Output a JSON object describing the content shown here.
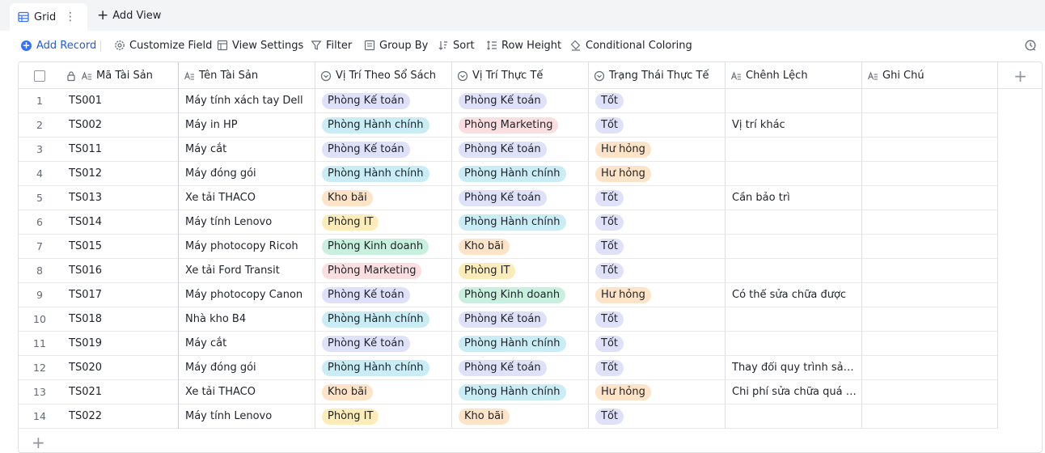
{
  "view_tab": {
    "label": "Grid",
    "more": "⋮"
  },
  "add_view": {
    "label": "Add View",
    "plus": "+"
  },
  "toolbar": {
    "add_record": "Add Record",
    "customize_field": "Customize Field",
    "view_settings": "View Settings",
    "filter": "Filter",
    "group_by": "Group By",
    "sort": "Sort",
    "row_height": "Row Height",
    "conditional_coloring": "Conditional Coloring"
  },
  "columns": [
    "Mã Tài Sản",
    "Tên Tài Sản",
    "Vị Trí Theo Sổ Sách",
    "Vị Trí Thực Tế",
    "Trạng Thái Thực Tế",
    "Chênh Lệch",
    "Ghi Chú"
  ],
  "colors": {
    "accent": "#3370ff",
    "tag_ketoan": "#dfe1f9",
    "tag_hanhchinh": "#c9ecf5",
    "tag_marketing": "#fbdedf",
    "tag_khobai": "#fde3c7",
    "tag_it": "#fcecb9",
    "tag_kinhdoanh": "#c9f0df",
    "tag_tot": "#dfe1f9",
    "tag_huhong": "#fde3c7"
  },
  "rows": [
    {
      "n": "1",
      "code": "TS001",
      "name": "Máy tính xách tay Dell",
      "book": "Phòng Kế toán",
      "actual": "Phòng Kế toán",
      "status": "Tốt",
      "diff": "",
      "note": ""
    },
    {
      "n": "2",
      "code": "TS002",
      "name": "Máy in HP",
      "book": "Phòng Hành chính",
      "actual": "Phòng Marketing",
      "status": "Tốt",
      "diff": "Vị trí khác",
      "note": ""
    },
    {
      "n": "3",
      "code": "TS011",
      "name": "Máy cắt",
      "book": "Phòng Kế toán",
      "actual": "Phòng Kế toán",
      "status": "Hư hỏng",
      "diff": "",
      "note": ""
    },
    {
      "n": "4",
      "code": "TS012",
      "name": "Máy đóng gói",
      "book": "Phòng Hành chính",
      "actual": "Phòng Hành chính",
      "status": "Hư hỏng",
      "diff": "",
      "note": ""
    },
    {
      "n": "5",
      "code": "TS013",
      "name": "Xe tải THACO",
      "book": "Kho bãi",
      "actual": "Phòng Kế toán",
      "status": "Tốt",
      "diff": "Cần bảo trì",
      "note": ""
    },
    {
      "n": "6",
      "code": "TS014",
      "name": "Máy tính Lenovo",
      "book": "Phòng IT",
      "actual": "Phòng Hành chính",
      "status": "Tốt",
      "diff": "",
      "note": ""
    },
    {
      "n": "7",
      "code": "TS015",
      "name": "Máy photocopy Ricoh",
      "book": "Phòng Kinh doanh",
      "actual": "Kho bãi",
      "status": "Tốt",
      "diff": "",
      "note": ""
    },
    {
      "n": "8",
      "code": "TS016",
      "name": "Xe tải Ford Transit",
      "book": "Phòng Marketing",
      "actual": "Phòng IT",
      "status": "Tốt",
      "diff": "",
      "note": ""
    },
    {
      "n": "9",
      "code": "TS017",
      "name": "Máy photocopy Canon",
      "book": "Phòng Kế toán",
      "actual": "Phòng Kinh doanh",
      "status": "Hư hỏng",
      "diff": "Có thể sửa chữa được",
      "note": ""
    },
    {
      "n": "10",
      "code": "TS018",
      "name": "Nhà kho B4",
      "book": "Phòng Hành chính",
      "actual": "Phòng Kế toán",
      "status": "Tốt",
      "diff": "",
      "note": ""
    },
    {
      "n": "11",
      "code": "TS019",
      "name": "Máy cắt",
      "book": "Phòng Kế toán",
      "actual": "Phòng Hành chính",
      "status": "Tốt",
      "diff": "",
      "note": ""
    },
    {
      "n": "12",
      "code": "TS020",
      "name": "Máy đóng gói",
      "book": "Phòng Hành chính",
      "actual": "Phòng Kế toán",
      "status": "Tốt",
      "diff": "Thay đổi quy trình sản x...",
      "note": ""
    },
    {
      "n": "13",
      "code": "TS021",
      "name": "Xe tải THACO",
      "book": "Kho bãi",
      "actual": "Phòng Hành chính",
      "status": "Hư hỏng",
      "diff": "Chi phí sửa chữa quá cao",
      "note": ""
    },
    {
      "n": "14",
      "code": "TS022",
      "name": "Máy tính Lenovo",
      "book": "Phòng IT",
      "actual": "Kho bãi",
      "status": "Tốt",
      "diff": "",
      "note": ""
    }
  ]
}
